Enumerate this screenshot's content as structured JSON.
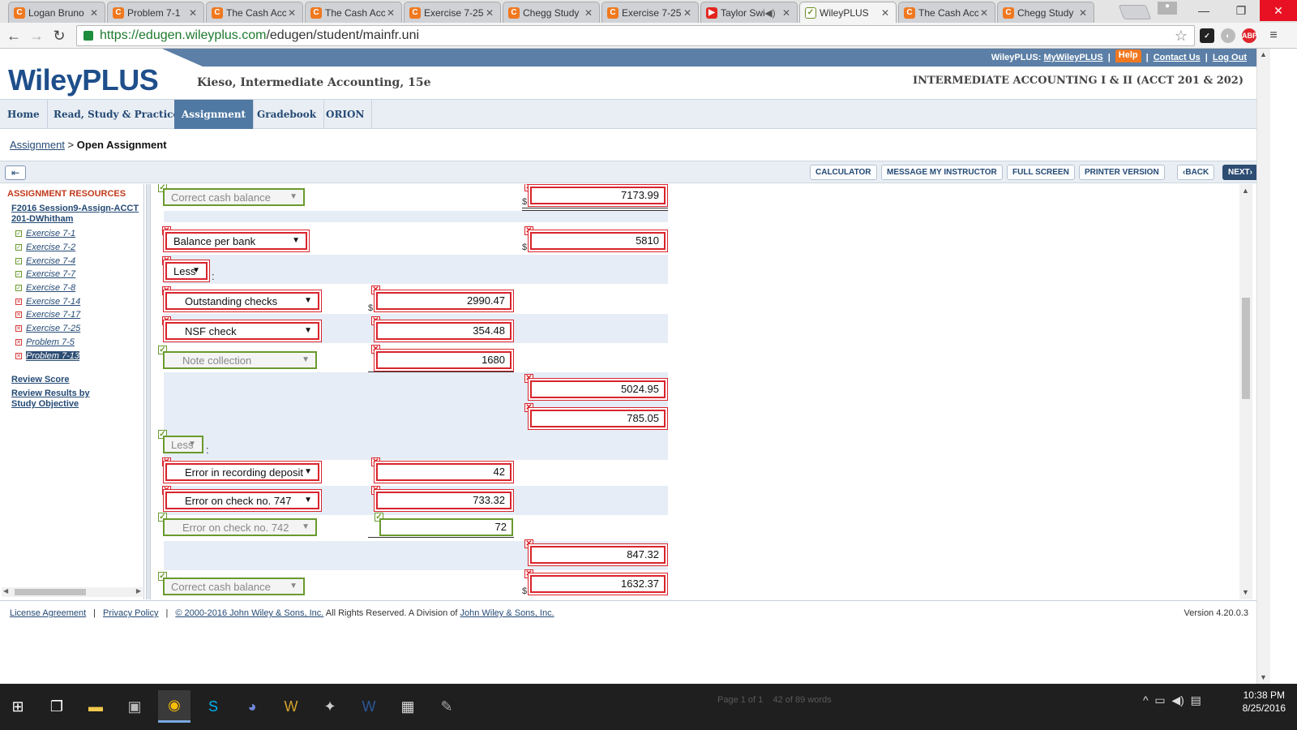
{
  "browser": {
    "tabs": [
      {
        "label": "Logan Bruno",
        "icon": "chegg-icon"
      },
      {
        "label": "Problem 7-1",
        "icon": "chegg-icon"
      },
      {
        "label": "The Cash Acc",
        "icon": "chegg-icon"
      },
      {
        "label": "The Cash Acc",
        "icon": "chegg-icon"
      },
      {
        "label": "Exercise 7-25",
        "icon": "chegg-icon"
      },
      {
        "label": "Chegg Study",
        "icon": "chegg-icon"
      },
      {
        "label": "Exercise 7-25",
        "icon": "chegg-icon"
      },
      {
        "label": "Taylor Swi",
        "icon": "youtube-icon"
      },
      {
        "label": "WileyPLUS",
        "icon": "wileyplus-icon",
        "active": true
      },
      {
        "label": "The Cash Acc",
        "icon": "chegg-icon"
      },
      {
        "label": "Chegg Study",
        "icon": "chegg-icon"
      }
    ],
    "url_scheme": "https://",
    "url_host": "edugen.wileyplus.com",
    "url_path": "/edugen/student/mainfr.uni",
    "ext_abp": "ABP"
  },
  "header": {
    "toplinks_prefix": "WileyPLUS:",
    "my_wileyplus": "MyWileyPLUS",
    "help": "Help",
    "contact": "Contact Us",
    "logout": "Log Out",
    "logo": "WileyPLUS",
    "book_title": "Kieso, Intermediate Accounting, 15e",
    "course_title": "INTERMEDIATE ACCOUNTING I & II (ACCT 201 & 202)"
  },
  "nav": {
    "tabs": [
      "Home",
      "Read, Study & Practice",
      "Assignment",
      "Gradebook",
      "ORION"
    ]
  },
  "breadcrumb": {
    "link": "Assignment",
    "sep": ">",
    "current": "Open Assignment"
  },
  "actions": {
    "calculator": "CALCULATOR",
    "message": "MESSAGE MY INSTRUCTOR",
    "fullscreen": "FULL SCREEN",
    "printer": "PRINTER VERSION",
    "back": "BACK",
    "next": "NEXT"
  },
  "resources": {
    "title": "ASSIGNMENT RESOURCES",
    "set_name": "F2016 Session9-Assign-ACCT 201-DWhitham",
    "items": [
      {
        "label": "Exercise 7-1",
        "status": "correct"
      },
      {
        "label": "Exercise 7-2",
        "status": "correct"
      },
      {
        "label": "Exercise 7-4",
        "status": "correct"
      },
      {
        "label": "Exercise 7-7",
        "status": "correct"
      },
      {
        "label": "Exercise 7-8",
        "status": "correct"
      },
      {
        "label": "Exercise 7-14",
        "status": "incorrect"
      },
      {
        "label": "Exercise 7-17",
        "status": "incorrect"
      },
      {
        "label": "Exercise 7-25",
        "status": "incorrect"
      },
      {
        "label": "Problem 7-5",
        "status": "incorrect"
      },
      {
        "label": "Problem 7-13",
        "status": "incorrect",
        "current": true
      }
    ],
    "review_score": "Review Score",
    "review_results": "Review Results by Study Objective"
  },
  "worksheet": {
    "dollar": "$",
    "colon": ":",
    "rows": {
      "r1_select": "Correct cash balance",
      "r1_total": "7173.99",
      "r2_select": "Balance per bank",
      "r2_total": "5810",
      "r3_select": "Less",
      "r4_select": "Outstanding checks",
      "r4_value": "2990.47",
      "r5_select": "NSF check",
      "r5_value": "354.48",
      "r6_select": "Note collection",
      "r6_value": "1680",
      "r7_total": "5024.95",
      "r8_total": "785.05",
      "r9_select": "Less",
      "r10_select": "Error in recording deposit",
      "r10_value": "42",
      "r11_select": "Error on check no. 747",
      "r11_value": "733.32",
      "r12_select": "Error on check no. 742",
      "r12_value": "72",
      "r13_total": "847.32",
      "r14_select": "Correct cash balance",
      "r14_total": "1632.37"
    }
  },
  "footer": {
    "license": "License Agreement",
    "privacy": "Privacy Policy",
    "copyright_link": "© 2000-2016 John Wiley & Sons, Inc.",
    "copyright_text": " All Rights Reserved. A Division of ",
    "division_link": "John Wiley & Sons, Inc.",
    "version": "Version 4.20.0.3"
  },
  "taskbar": {
    "word_status_page": "Page 1 of 1",
    "word_status_words": "42 of 89 words",
    "time": "10:38 PM",
    "date": "8/25/2016"
  },
  "colors": {
    "wiley_blue": "#1f4f8b",
    "nav_active": "#4f78a3",
    "incorrect_red": "#d9242c",
    "correct_green": "#6a9a2e",
    "help_orange": "#f07820"
  }
}
